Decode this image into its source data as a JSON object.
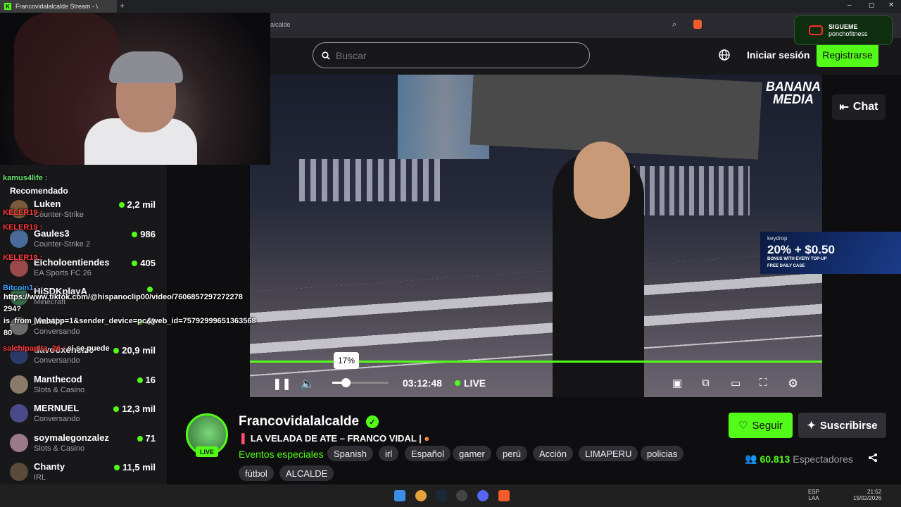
{
  "browser": {
    "tab_title": "Francovidalalcalde Stream - \\",
    "new_tab": "+",
    "window_controls": [
      "–",
      "◻",
      "✕"
    ],
    "address_partial": "alcalde"
  },
  "header": {
    "search_placeholder": "Buscar",
    "login_label": "Iniciar sesión",
    "register_label": "Registrarse"
  },
  "overlay": {
    "yt_line1": "SIGUEME",
    "yt_line2": "ponchofitness",
    "banana": "BANANA\nMEDIA",
    "ad_brand": "keydrop",
    "ad_big": "20% + $0.50",
    "ad_sub": "BONUS WITH EVERY TOP-UP",
    "ad_sub2": "FREE DAILY CASE"
  },
  "player": {
    "volume_tooltip": "17%",
    "volume_level": 0.17,
    "time": "03:12:48",
    "live_label": "LIVE",
    "chat_label": "Chat"
  },
  "sidebar": {
    "section_title": "Recomendado",
    "items": [
      {
        "name": "Luken",
        "category": "Counter-Strike",
        "viewers": "2,2 mil"
      },
      {
        "name": "Gaules3",
        "category": "Counter-Strike 2",
        "viewers": "986"
      },
      {
        "name": "Elcholoentiendes",
        "category": "EA Sports FC 26",
        "viewers": "405"
      },
      {
        "name": "HiSDKplayA",
        "category": "Minecraft",
        "viewers": ""
      },
      {
        "name": "Mantte",
        "category": "Conversando",
        "viewers": "40"
      },
      {
        "name": "davooxeneize",
        "category": "Conversando",
        "viewers": "20,9 mil"
      },
      {
        "name": "Manthecod",
        "category": "Slots & Casino",
        "viewers": "16"
      },
      {
        "name": "MERNUEL",
        "category": "Conversando",
        "viewers": "12,3 mil"
      },
      {
        "name": "soymalegonzalez",
        "category": "Slots & Casino",
        "viewers": "71"
      },
      {
        "name": "Chanty",
        "category": "IRL",
        "viewers": "11,5 mil"
      }
    ]
  },
  "chat_overlay": [
    {
      "user": "kamus4life :",
      "msg": "",
      "color": "#6fe36f"
    },
    {
      "user": "KELER19 :",
      "msg": "",
      "color": "#ff3b3b"
    },
    {
      "user": "KELER19 :",
      "msg": "",
      "color": "#ff3b3b"
    },
    {
      "user": "KELER19 :",
      "msg": "",
      "color": "#ff3b3b"
    },
    {
      "user": "Bitcoin1 :",
      "msg": "",
      "color": "#3aa0ff"
    },
    {
      "user": "",
      "msg": "https://www.tiktok.com/@hispanoclip00/video/7606857297272278",
      "color": "#ffffff"
    },
    {
      "user": "",
      "msg": "294?",
      "color": "#ffffff"
    },
    {
      "user": "",
      "msg": "is_from_webapp=1&sender_device=pc&web_id=75792999651363568",
      "color": "#ffffff"
    },
    {
      "user": "",
      "msg": "80",
      "color": "#ffffff"
    },
    {
      "user": "salchipapita_26 :",
      "msg": "si se puede",
      "color": "#ff3b3b"
    }
  ],
  "channel": {
    "name": "Francovidalalcalde",
    "live_badge": "LIVE",
    "stream_title": "LA VELADA DE ATE – FRANCO VIDAL |",
    "category": "Eventos especiales",
    "tags": [
      "Spanish",
      "irl",
      "Español",
      "gamer",
      "perú",
      "Acción",
      "LIMAPERU",
      "policias",
      "fútbol",
      "ALCALDE"
    ],
    "follow_label": "Seguir",
    "subscribe_label": "Suscribirse",
    "viewers_count": "60.813",
    "viewers_label": "Espectadores"
  },
  "taskbar": {
    "lang_line1": "ESP",
    "lang_line2": "LAA",
    "time": "21:52",
    "date": "15/02/2026"
  },
  "colors": {
    "accent": "#53fc18",
    "bg": "#0e0e10",
    "panel": "#18181b"
  }
}
